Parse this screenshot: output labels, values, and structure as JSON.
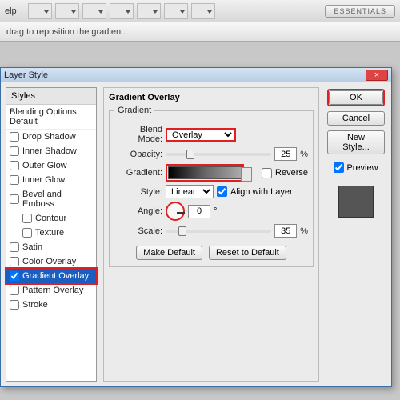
{
  "menubar": {
    "help": "elp",
    "essentials": "ESSENTIALS"
  },
  "optbar": {
    "hint": "drag to reposition the gradient."
  },
  "dialog": {
    "title": "Layer Style",
    "styles_header": "Styles",
    "blending": "Blending Options: Default",
    "items": {
      "drop_shadow": "Drop Shadow",
      "inner_shadow": "Inner Shadow",
      "outer_glow": "Outer Glow",
      "inner_glow": "Inner Glow",
      "bevel": "Bevel and Emboss",
      "contour": "Contour",
      "texture": "Texture",
      "satin": "Satin",
      "color_overlay": "Color Overlay",
      "gradient_overlay": "Gradient Overlay",
      "pattern_overlay": "Pattern Overlay",
      "stroke": "Stroke"
    }
  },
  "settings": {
    "heading": "Gradient Overlay",
    "legend": "Gradient",
    "blend_label": "Blend Mode:",
    "blend_value": "Overlay",
    "opacity_label": "Opacity:",
    "opacity_value": "25",
    "gradient_label": "Gradient:",
    "reverse_label": "Reverse",
    "style_label": "Style:",
    "style_value": "Linear",
    "align_label": "Align with Layer",
    "angle_label": "Angle:",
    "angle_value": "0",
    "angle_unit": "°",
    "scale_label": "Scale:",
    "scale_value": "35",
    "pct": "%",
    "make_default": "Make Default",
    "reset_default": "Reset to Default"
  },
  "buttons": {
    "ok": "OK",
    "cancel": "Cancel",
    "new_style": "New Style...",
    "preview": "Preview"
  }
}
